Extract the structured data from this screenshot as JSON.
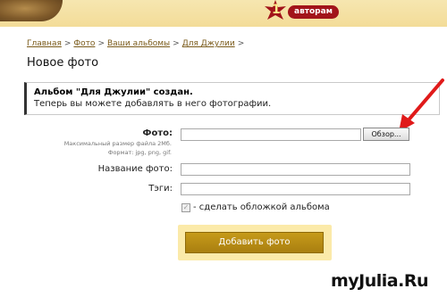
{
  "header": {
    "badge_number": "1",
    "badge_label": "авторам"
  },
  "breadcrumb": {
    "items": [
      "Главная",
      "Фото",
      "Ваши альбомы",
      "Для Джулии"
    ],
    "separator": ">"
  },
  "page_title": "Новое фото",
  "notice": {
    "title": "Альбом \"Для Джулии\" создан.",
    "text": "Теперь вы можете добавлять в него фотографии."
  },
  "form": {
    "photo_label": "Фото:",
    "photo_hint_size": "Максимальный размер файла 2Мб.",
    "photo_hint_format": "Формат: jpg, png, gif.",
    "photo_value": "",
    "browse_label": "Обзор...",
    "name_label": "Название фото:",
    "name_value": "",
    "tags_label": "Тэги:",
    "tags_value": "",
    "cover_checked": true,
    "cover_label": "- сделать обложкой альбома",
    "submit_label": "Добавить фото"
  },
  "watermark": "myJulia.Ru",
  "colors": {
    "accent_gold": "#b98d14",
    "header_bg": "#f3dc98",
    "badge_red": "#a2141a",
    "arrow_red": "#e01a1a"
  }
}
